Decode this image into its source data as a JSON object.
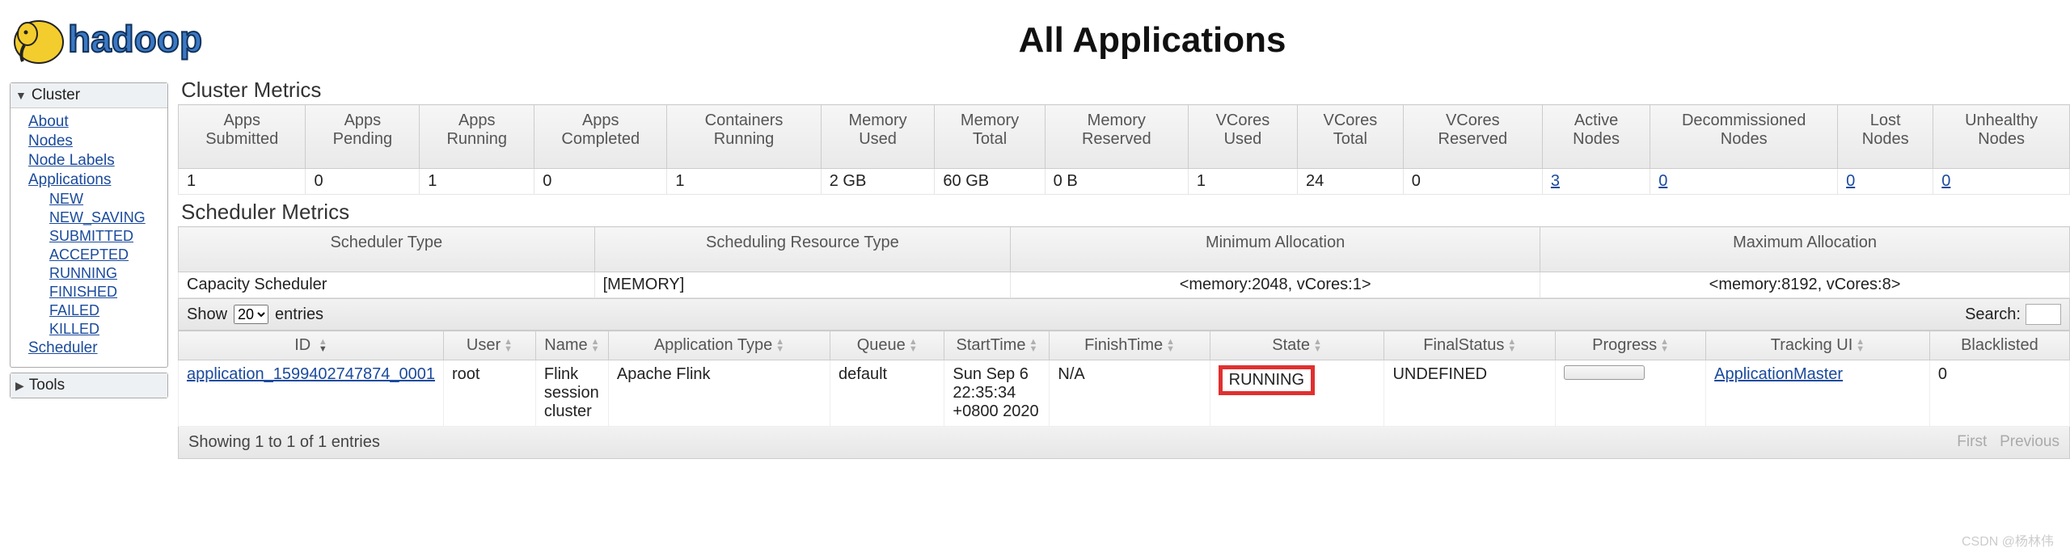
{
  "header": {
    "title": "All Applications"
  },
  "sidebar": {
    "cluster": {
      "label": "Cluster",
      "items": {
        "about": "About",
        "nodes": "Nodes",
        "node_labels": "Node Labels",
        "applications": "Applications",
        "scheduler": "Scheduler"
      },
      "app_states": {
        "new": "NEW",
        "new_saving": "NEW_SAVING",
        "submitted": "SUBMITTED",
        "accepted": "ACCEPTED",
        "running": "RUNNING",
        "finished": "FINISHED",
        "failed": "FAILED",
        "killed": "KILLED"
      }
    },
    "tools": {
      "label": "Tools"
    }
  },
  "cluster_metrics": {
    "title": "Cluster Metrics",
    "headers": {
      "apps_submitted": "Apps Submitted",
      "apps_pending": "Apps Pending",
      "apps_running": "Apps Running",
      "apps_completed": "Apps Completed",
      "containers_running": "Containers Running",
      "memory_used": "Memory Used",
      "memory_total": "Memory Total",
      "memory_reserved": "Memory Reserved",
      "vcores_used": "VCores Used",
      "vcores_total": "VCores Total",
      "vcores_reserved": "VCores Reserved",
      "active_nodes": "Active Nodes",
      "decommissioned_nodes": "Decommissioned Nodes",
      "lost_nodes": "Lost Nodes",
      "unhealthy_nodes": "Unhealthy Nodes"
    },
    "row": {
      "apps_submitted": "1",
      "apps_pending": "0",
      "apps_running": "1",
      "apps_completed": "0",
      "containers_running": "1",
      "memory_used": "2 GB",
      "memory_total": "60 GB",
      "memory_reserved": "0 B",
      "vcores_used": "1",
      "vcores_total": "24",
      "vcores_reserved": "0",
      "active_nodes": "3",
      "decommissioned_nodes": "0",
      "lost_nodes": "0",
      "unhealthy_nodes": "0"
    }
  },
  "scheduler_metrics": {
    "title": "Scheduler Metrics",
    "headers": {
      "scheduler_type": "Scheduler Type",
      "scheduling_resource_type": "Scheduling Resource Type",
      "minimum_allocation": "Minimum Allocation",
      "maximum_allocation": "Maximum Allocation"
    },
    "row": {
      "scheduler_type": "Capacity Scheduler",
      "scheduling_resource_type": "[MEMORY]",
      "minimum_allocation": "<memory:2048, vCores:1>",
      "maximum_allocation": "<memory:8192, vCores:8>"
    }
  },
  "datatable": {
    "show_label": "Show",
    "entries_label": "entries",
    "page_size": "20",
    "search_label": "Search:",
    "headers": {
      "id": "ID",
      "user": "User",
      "name": "Name",
      "application_type": "Application Type",
      "queue": "Queue",
      "start_time": "StartTime",
      "finish_time": "FinishTime",
      "state": "State",
      "final_status": "FinalStatus",
      "progress": "Progress",
      "tracking_ui": "Tracking UI",
      "blacklisted": "Blacklisted"
    },
    "rows": [
      {
        "id": "application_1599402747874_0001",
        "user": "root",
        "name": "Flink session cluster",
        "application_type": "Apache Flink",
        "queue": "default",
        "start_time": "Sun Sep 6 22:35:34 +0800 2020",
        "finish_time": "N/A",
        "state": "RUNNING",
        "final_status": "UNDEFINED",
        "tracking_ui": "ApplicationMaster",
        "blacklisted": "0"
      }
    ],
    "info": "Showing 1 to 1 of 1 entries",
    "pager": {
      "first": "First",
      "previous": "Previous"
    }
  },
  "watermark": {
    "line1": "CSDN @杨林伟"
  }
}
